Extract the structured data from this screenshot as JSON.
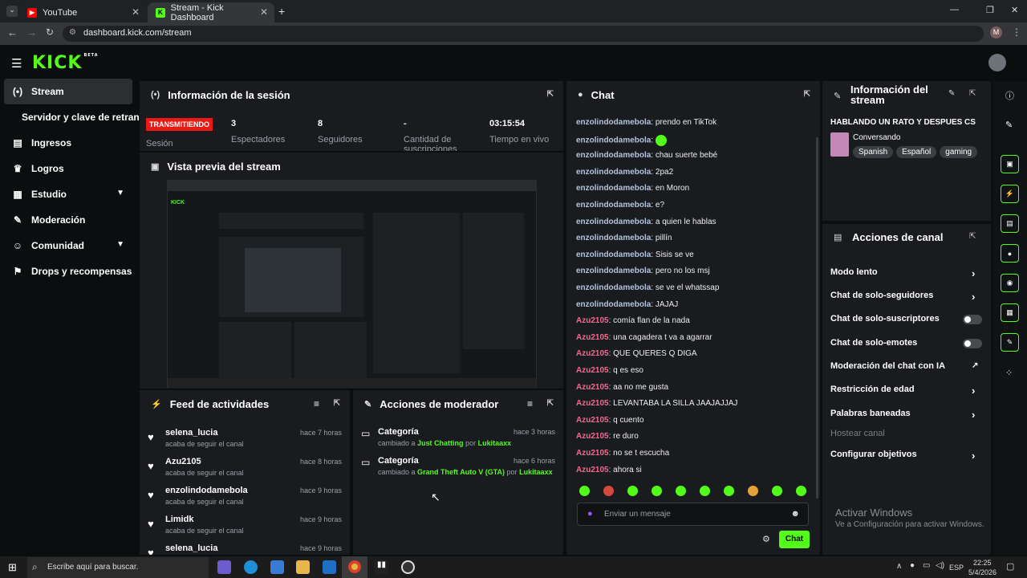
{
  "browser": {
    "tabs": [
      {
        "title": "YouTube",
        "icon": "youtube-icon"
      },
      {
        "title": "Stream - Kick Dashboard",
        "icon": "kick-icon"
      }
    ],
    "url": "dashboard.kick.com/stream",
    "profile_initial": "M"
  },
  "app": {
    "logo": "KICK",
    "logo_badge": "BETA"
  },
  "sidebar": {
    "items": [
      {
        "label": "Stream",
        "icon": "broadcast-icon"
      },
      {
        "label": "Servidor y clave de retransmisión",
        "icon": ""
      },
      {
        "label": "Ingresos",
        "icon": "income-icon"
      },
      {
        "label": "Logros",
        "icon": "trophy-icon"
      },
      {
        "label": "Estudio",
        "icon": "studio-icon"
      },
      {
        "label": "Moderación",
        "icon": "wrench-icon"
      },
      {
        "label": "Comunidad",
        "icon": "community-icon"
      },
      {
        "label": "Drops y recompensas",
        "icon": "gift-icon"
      }
    ]
  },
  "session": {
    "title": "Información de la sesión",
    "badge": "TRANSMITIENDO",
    "badge_label": "Sesión",
    "stats": [
      {
        "value": "3",
        "label": "Espectadores"
      },
      {
        "value": "8",
        "label": "Seguidores"
      },
      {
        "value": "-",
        "label": "Cantidad de suscripciones"
      },
      {
        "value": "03:15:54",
        "label": "Tiempo en vivo"
      }
    ]
  },
  "preview": {
    "title": "Vista previa del stream"
  },
  "feed": {
    "title": "Feed de actividades",
    "items": [
      {
        "name": "selena_lucia",
        "text": "acaba de seguir el canal",
        "time": "hace 7 horas"
      },
      {
        "name": "Azu2105",
        "text": "acaba de seguir el canal",
        "time": "hace 8 horas"
      },
      {
        "name": "enzolindodamebola",
        "text": "acaba de seguir el canal",
        "time": "hace 9 horas"
      },
      {
        "name": "Limidk",
        "text": "acaba de seguir el canal",
        "time": "hace 9 horas"
      },
      {
        "name": "selena_lucia",
        "text": "",
        "time": "hace 9 horas"
      }
    ]
  },
  "modactions": {
    "title": "Acciones de moderador",
    "items": [
      {
        "title": "Categoría",
        "prefix": "cambiado a",
        "category": "Just Chatting",
        "by": "por",
        "user": "Lukitaaxx",
        "time": "hace 3 horas"
      },
      {
        "title": "Categoría",
        "prefix": "cambiado a",
        "category": "Grand Theft Auto V (GTA)",
        "by": "por",
        "user": "Lukitaaxx",
        "time": "hace 6 horas"
      }
    ]
  },
  "chat": {
    "title": "Chat",
    "messages": [
      {
        "user": "enzolindodamebola",
        "text": "prendo en TikTok",
        "color": "#b2c4df"
      },
      {
        "user": "enzolindodamebola",
        "text": "",
        "emote": true,
        "color": "#b2c4df"
      },
      {
        "user": "enzolindodamebola",
        "text": "chau suerte bebé",
        "color": "#b2c4df"
      },
      {
        "user": "enzolindodamebola",
        "text": "2pa2",
        "color": "#b2c4df"
      },
      {
        "user": "enzolindodamebola",
        "text": "en Moron",
        "color": "#b2c4df"
      },
      {
        "user": "enzolindodamebola",
        "text": "e?",
        "color": "#b2c4df"
      },
      {
        "user": "enzolindodamebola",
        "text": "a quien le hablas",
        "color": "#b2c4df"
      },
      {
        "user": "enzolindodamebola",
        "text": "pillín",
        "color": "#b2c4df"
      },
      {
        "user": "enzolindodamebola",
        "text": "Sisis se ve",
        "color": "#b2c4df"
      },
      {
        "user": "enzolindodamebola",
        "text": "pero no los msj",
        "color": "#b2c4df"
      },
      {
        "user": "enzolindodamebola",
        "text": "se ve el whatssap",
        "color": "#b2c4df"
      },
      {
        "user": "enzolindodamebola",
        "text": "JAJAJ",
        "color": "#b2c4df"
      },
      {
        "user": "Azu2105",
        "text": "comía flan de la nada",
        "color": "#f06b8f"
      },
      {
        "user": "Azu2105",
        "text": "una cagadera t va a agarrar",
        "color": "#f06b8f"
      },
      {
        "user": "Azu2105",
        "text": "QUE QUERES Q DIGA",
        "color": "#f06b8f"
      },
      {
        "user": "Azu2105",
        "text": "q es eso",
        "color": "#f06b8f"
      },
      {
        "user": "Azu2105",
        "text": "aa no me gusta",
        "color": "#f06b8f"
      },
      {
        "user": "Azu2105",
        "text": "LEVANTABA LA SILLA JAAJAJJAJ",
        "color": "#f06b8f"
      },
      {
        "user": "Azu2105",
        "text": "q cuento",
        "color": "#f06b8f"
      },
      {
        "user": "Azu2105",
        "text": "re duro",
        "color": "#f06b8f"
      },
      {
        "user": "Azu2105",
        "text": "no se t escucha",
        "color": "#f06b8f"
      },
      {
        "user": "Azu2105",
        "text": "ahora si",
        "color": "#f06b8f"
      }
    ],
    "input_placeholder": "Enviar un mensaje",
    "send_label": "Chat"
  },
  "streaminfo": {
    "title": "Información del stream",
    "stream_title": "HABLANDO UN RATO Y DESPUES CS",
    "category": "Conversando",
    "tags": [
      "Spanish",
      "Español",
      "gaming"
    ]
  },
  "channel": {
    "title": "Acciones de canal",
    "items": [
      {
        "label": "Modo lento",
        "control": "arrow"
      },
      {
        "label": "Chat de solo-seguidores",
        "control": "arrow"
      },
      {
        "label": "Chat de solo-suscriptores",
        "control": "toggle"
      },
      {
        "label": "Chat de solo-emotes",
        "control": "toggle"
      },
      {
        "label": "Moderación del chat con IA",
        "control": "link"
      },
      {
        "label": "Restricción de edad",
        "control": "arrow"
      },
      {
        "label": "Palabras baneadas",
        "control": "arrow"
      },
      {
        "label": "Hostear canal",
        "control": "none",
        "disabled": true
      },
      {
        "label": "Configurar objetivos",
        "control": "arrow"
      }
    ]
  },
  "watermark": {
    "title": "Activar Windows",
    "subtitle": "Ve a Configuración para activar Windows."
  },
  "taskbar": {
    "search_placeholder": "Escribe aquí para buscar.",
    "lang": "ESP",
    "time": "22:25",
    "date": "5/4/2026"
  },
  "colors": {
    "accent": "#53fc18",
    "live": "#e91916",
    "panel": "#191b1f"
  }
}
